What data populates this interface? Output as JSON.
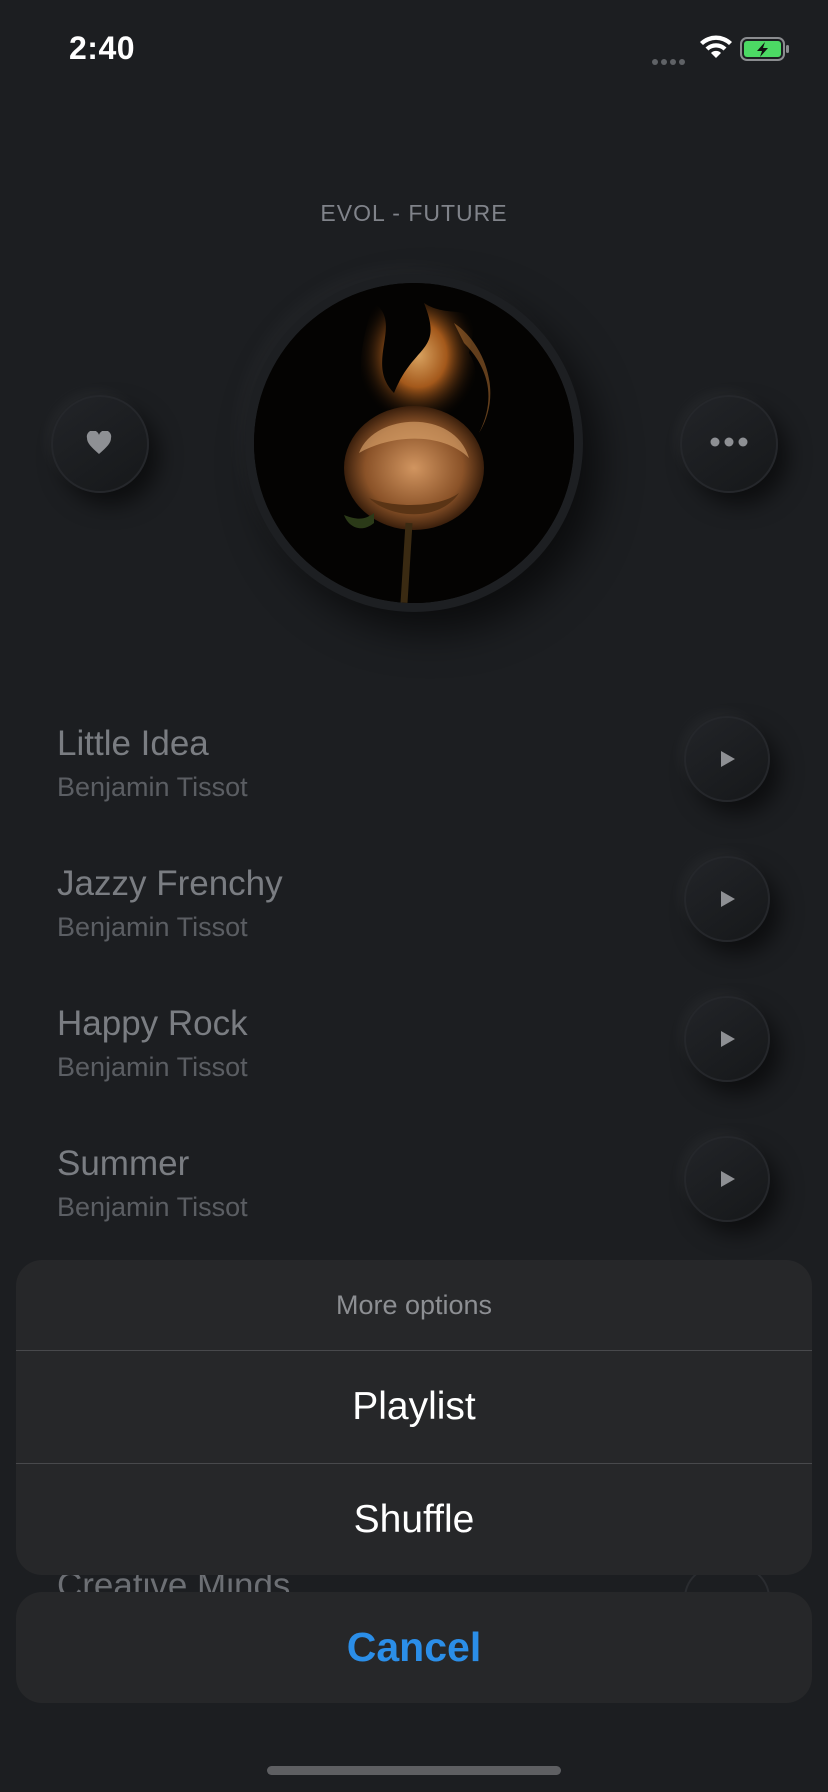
{
  "status_bar": {
    "time": "2:40"
  },
  "album": {
    "title": "EVOL - FUTURE"
  },
  "icons": {
    "favorite": "heart-icon",
    "more": "ellipsis-icon",
    "play": "play-icon",
    "wifi": "wifi-icon",
    "battery": "battery-charging-icon"
  },
  "tracks": [
    {
      "title": "Little Idea",
      "artist": "Benjamin Tissot"
    },
    {
      "title": "Jazzy Frenchy",
      "artist": "Benjamin Tissot"
    },
    {
      "title": "Happy Rock",
      "artist": "Benjamin Tissot"
    },
    {
      "title": "Summer",
      "artist": "Benjamin Tissot"
    },
    {
      "title": "Creative Minds",
      "artist": ""
    }
  ],
  "action_sheet": {
    "title": "More options",
    "options": [
      "Playlist",
      "Shuffle"
    ],
    "cancel_label": "Cancel"
  },
  "colors": {
    "background": "#1c1e21",
    "sheet": "#262729",
    "accent": "#2b8ee8",
    "battery_green": "#4cd964"
  }
}
